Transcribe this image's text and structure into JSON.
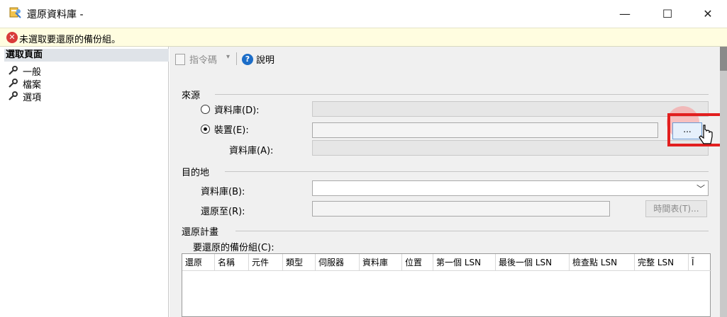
{
  "window": {
    "title": "還原資料庫 -",
    "minimize": "—",
    "maximize": "☐",
    "close": "✕"
  },
  "warning": {
    "icon": "✕",
    "text": "未選取要還原的備份組。"
  },
  "left": {
    "header": "選取頁面",
    "items": [
      {
        "label": "一般"
      },
      {
        "label": "檔案"
      },
      {
        "label": "選項"
      }
    ]
  },
  "toolbar": {
    "script_label": "指令碼",
    "caret": "▾",
    "help_label": "說明",
    "help_icon": "?"
  },
  "source": {
    "section": "來源",
    "database_radio": "資料庫(D):",
    "device_radio": "裝置(E):",
    "database_label": "資料庫(A):",
    "browse_label": "...",
    "selected": "device"
  },
  "destination": {
    "section": "目的地",
    "database_label": "資料庫(B):",
    "restore_to_label": "還原至(R):",
    "schedule_button": "時間表(T)...",
    "dropdown_arrow": "﹀"
  },
  "plan": {
    "section": "還原計畫",
    "backup_sets_label": "要還原的備份組(C):",
    "columns": [
      "還原",
      "名稱",
      "元件",
      "類型",
      "伺服器",
      "資料庫",
      "位置",
      "第一個 LSN",
      "最後一個 LSN",
      "檢查點 LSN",
      "完整 LSN",
      "Ī"
    ]
  },
  "colors": {
    "warning_bg": "#fffde0",
    "highlight": "#e21f1f",
    "help_blue": "#1c6dc8"
  }
}
